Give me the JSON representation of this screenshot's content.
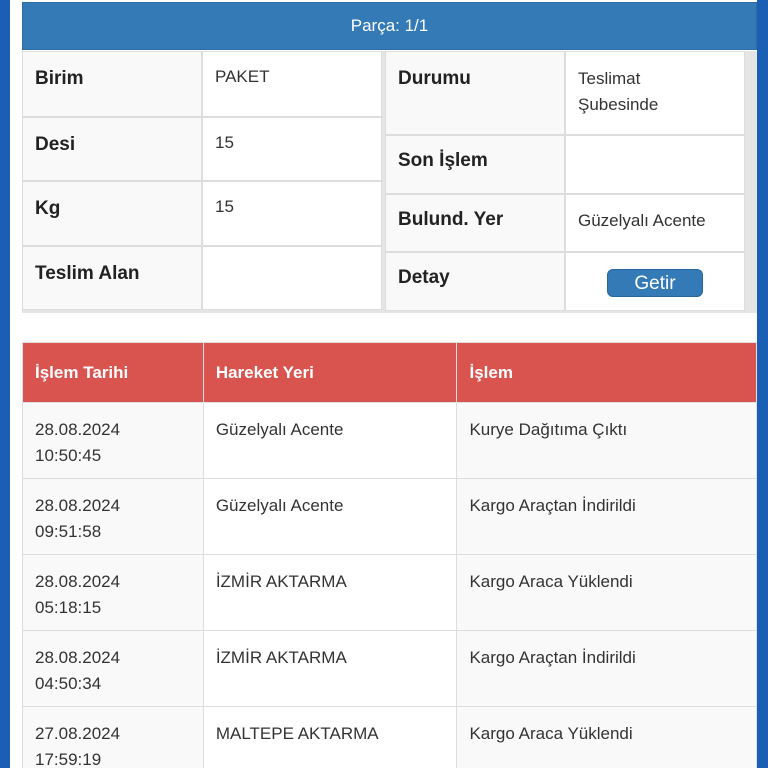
{
  "part_header": "Parça: 1/1",
  "left_info": [
    {
      "label": "Birim",
      "value": "PAKET"
    },
    {
      "label": "Desi",
      "value": "15"
    },
    {
      "label": "Kg",
      "value": "15"
    },
    {
      "label": "Teslim Alan",
      "value": ""
    }
  ],
  "right_info": [
    {
      "label": "Durumu",
      "value_line1": "Teslimat",
      "value_line2": "Şubesinde"
    },
    {
      "label": "Son İşlem",
      "value": ""
    },
    {
      "label": "Bulund. Yer",
      "value": "Güzelyalı Acente"
    },
    {
      "label": "Detay",
      "button": "Getir"
    }
  ],
  "history": {
    "headers": [
      "İşlem Tarihi",
      "Hareket Yeri",
      "İşlem"
    ],
    "rows": [
      {
        "date": "28.08.2024",
        "time": "10:50:45",
        "place": "Güzelyalı Acente",
        "action": "Kurye Dağıtıma Çıktı"
      },
      {
        "date": "28.08.2024",
        "time": "09:51:58",
        "place": "Güzelyalı Acente",
        "action": "Kargo Araçtan İndirildi"
      },
      {
        "date": "28.08.2024",
        "time": "05:18:15",
        "place": "İZMİR AKTARMA",
        "action": "Kargo Araca Yüklendi"
      },
      {
        "date": "28.08.2024",
        "time": "04:50:34",
        "place": "İZMİR AKTARMA",
        "action": "Kargo Araçtan İndirildi"
      },
      {
        "date": "27.08.2024",
        "time": "17:59:19",
        "place": "MALTEPE AKTARMA",
        "action": "Kargo Araca Yüklendi"
      }
    ]
  },
  "colors": {
    "header_blue": "#337ab7",
    "table_red": "#d9534f",
    "page_blue": "#1a5fb4"
  }
}
